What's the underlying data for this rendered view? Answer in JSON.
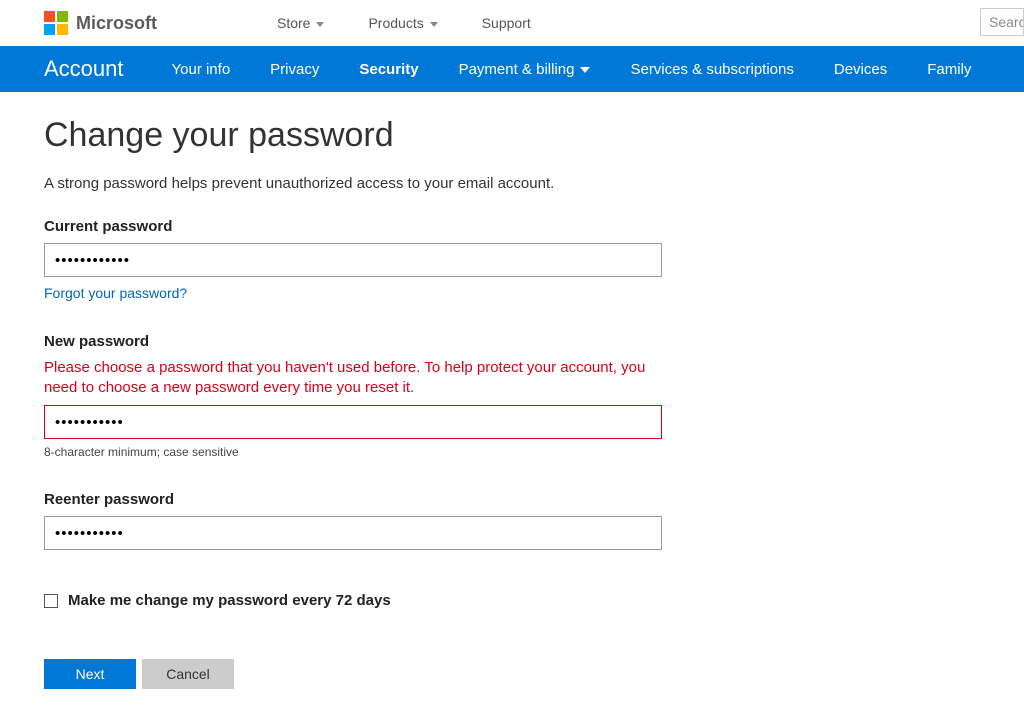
{
  "header": {
    "brand": "Microsoft",
    "nav": [
      {
        "label": "Store",
        "hasChevron": true
      },
      {
        "label": "Products",
        "hasChevron": true
      },
      {
        "label": "Support",
        "hasChevron": false
      }
    ],
    "search_placeholder": "Search"
  },
  "blue_nav": {
    "brand": "Account",
    "items": [
      {
        "label": "Your info",
        "active": false,
        "chevron": false
      },
      {
        "label": "Privacy",
        "active": false,
        "chevron": false
      },
      {
        "label": "Security",
        "active": true,
        "chevron": false
      },
      {
        "label": "Payment & billing",
        "active": false,
        "chevron": true
      },
      {
        "label": "Services & subscriptions",
        "active": false,
        "chevron": false
      },
      {
        "label": "Devices",
        "active": false,
        "chevron": false
      },
      {
        "label": "Family",
        "active": false,
        "chevron": false
      }
    ]
  },
  "page": {
    "title": "Change your password",
    "subtitle": "A strong password helps prevent unauthorized access to your email account.",
    "current_label": "Current password",
    "current_value": "••••••••••••",
    "forgot_link": "Forgot your password?",
    "new_label": "New password",
    "new_error": "Please choose a password that you haven't used before. To help protect your account, you need to choose a new password every time you reset it.",
    "new_value": "•••••••••••",
    "new_hint": "8-character minimum; case sensitive",
    "reenter_label": "Reenter password",
    "reenter_value": "•••••••••••",
    "checkbox_label": "Make me change my password every 72 days",
    "next_button": "Next",
    "cancel_button": "Cancel"
  }
}
